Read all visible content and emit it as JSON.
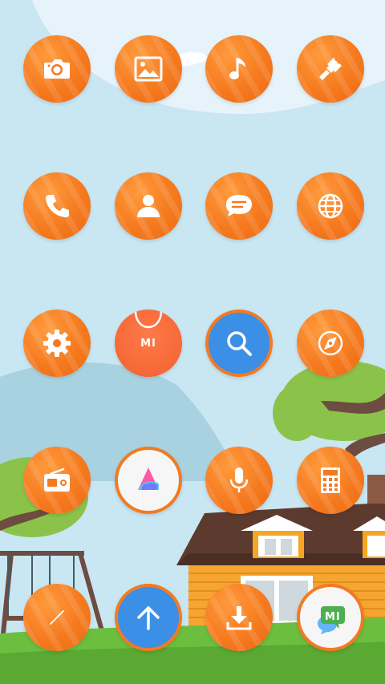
{
  "screen": {
    "type": "android-launcher-home",
    "theme_colors": {
      "icon_orange": "#f57a1f",
      "sky": "#c9e6f3",
      "grass": "#6cbf3e",
      "blue_accent": "#3b8fe6"
    }
  },
  "apps": [
    {
      "icon": "camera-icon"
    },
    {
      "icon": "gallery-icon"
    },
    {
      "icon": "music-icon"
    },
    {
      "icon": "themes-brush-icon"
    },
    {
      "icon": "phone-icon"
    },
    {
      "icon": "contacts-icon"
    },
    {
      "icon": "messages-icon"
    },
    {
      "icon": "browser-globe-icon"
    },
    {
      "icon": "settings-gear-icon"
    },
    {
      "icon": "mi-store-icon",
      "label": "MI"
    },
    {
      "icon": "search-icon"
    },
    {
      "icon": "compass-icon"
    },
    {
      "icon": "fm-radio-icon"
    },
    {
      "icon": "app-vault-icon"
    },
    {
      "icon": "voice-recorder-icon"
    },
    {
      "icon": "calculator-icon"
    },
    {
      "icon": "notes-pen-icon"
    },
    {
      "icon": "updater-arrow-icon"
    },
    {
      "icon": "downloads-icon"
    },
    {
      "icon": "mi-community-icon",
      "label": "MI"
    }
  ]
}
